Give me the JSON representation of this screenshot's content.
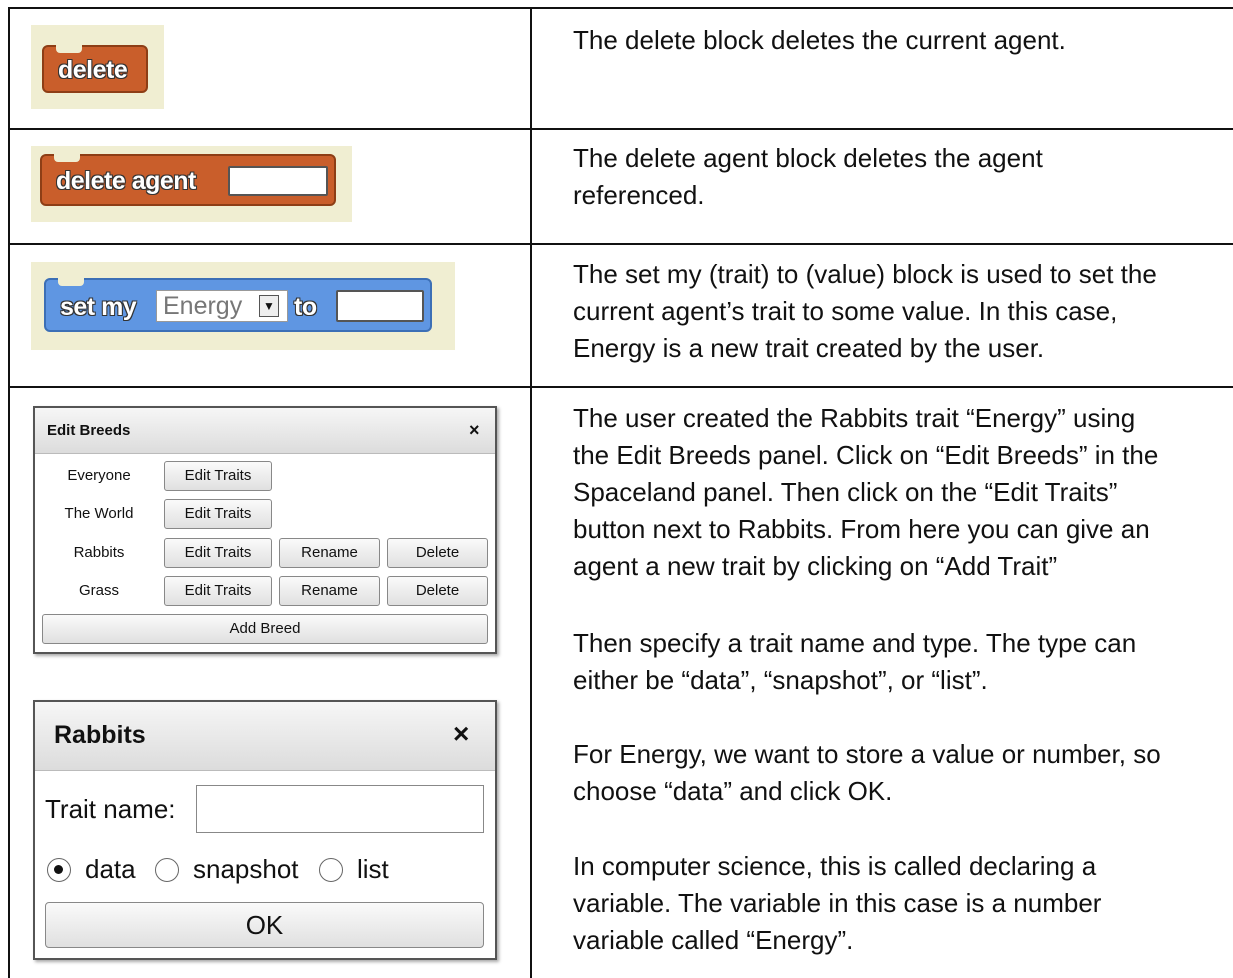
{
  "rows": [
    {
      "block_label": "delete",
      "description": [
        "The delete block deletes the current agent."
      ]
    },
    {
      "block_label": "delete agent",
      "description": [
        "The delete agent block deletes the agent",
        "referenced."
      ]
    },
    {
      "block_label_prefix": "set my",
      "dropdown_value": "Energy",
      "block_label_suffix": "to",
      "description": [
        "The set my (trait) to (value) block is used to set the",
        "current agent’s trait to some value.  In this case,",
        "Energy is a new trait created by the user."
      ]
    },
    {
      "description_paragraphs": [
        [
          "The user created the Rabbits trait “Energy” using",
          "the Edit Breeds panel.  Click on “Edit Breeds” in the",
          "Spaceland panel. Then click on the “Edit Traits”",
          "button next to Rabbits.  From here you can give an",
          "agent a new trait by clicking on “Add Trait”"
        ],
        [
          "Then specify a trait name and type.  The type can",
          "either be “data”, “snapshot”, or “list”."
        ],
        [
          "For Energy, we want to store a value or number, so",
          "choose “data” and click OK."
        ],
        [
          "In computer science, this is called declaring a",
          "variable. The variable in this case is a number",
          "variable called “Energy”."
        ]
      ]
    }
  ],
  "edit_breeds_panel": {
    "title": "Edit Breeds",
    "close": "×",
    "breeds": [
      {
        "name": "Everyone",
        "edit": "Edit Traits"
      },
      {
        "name": "The World",
        "edit": "Edit Traits"
      },
      {
        "name": "Rabbits",
        "edit": "Edit Traits",
        "rename": "Rename",
        "delete": "Delete"
      },
      {
        "name": "Grass",
        "edit": "Edit Traits",
        "rename": "Rename",
        "delete": "Delete"
      }
    ],
    "add_breed": "Add Breed"
  },
  "rabbits_panel": {
    "title": "Rabbits",
    "close": "×",
    "trait_name_label": "Trait name:",
    "trait_name_value": "",
    "types": [
      {
        "label": "data",
        "checked": true
      },
      {
        "label": "snapshot",
        "checked": false
      },
      {
        "label": "list",
        "checked": false
      }
    ],
    "ok": "OK"
  },
  "colors": {
    "orange_block": "#c95e2b",
    "blue_block": "#5f96e2",
    "block_background": "#f0eed2"
  }
}
